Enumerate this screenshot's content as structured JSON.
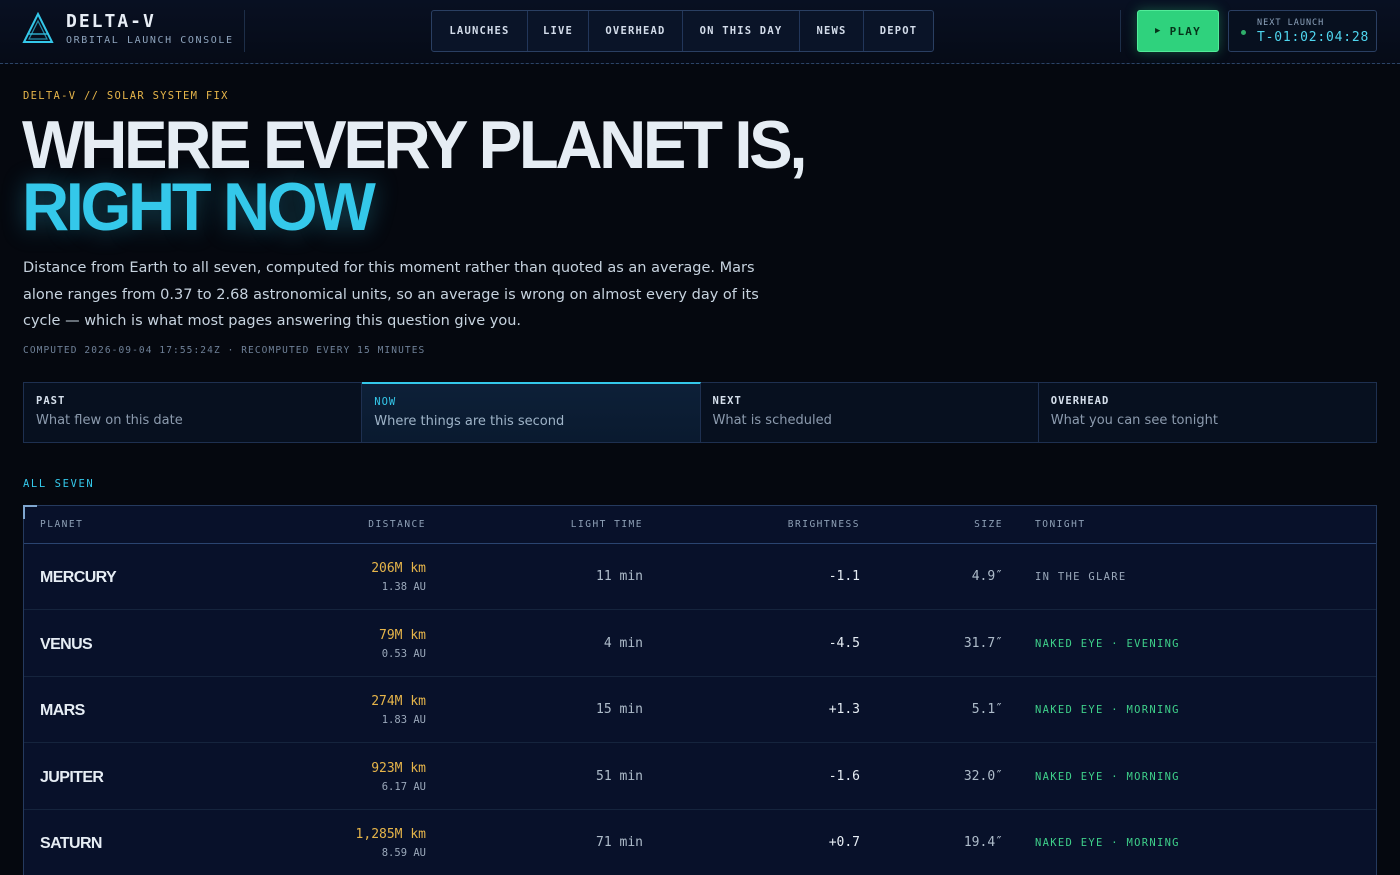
{
  "header": {
    "brand_name": "DELTA-V",
    "brand_sub": "ORBITAL LAUNCH CONSOLE",
    "nav": [
      "LAUNCHES",
      "LIVE",
      "OVERHEAD",
      "ON THIS DAY",
      "NEWS",
      "DEPOT"
    ],
    "play_label": "PLAY",
    "next_launch_label": "NEXT LAUNCH",
    "next_launch_value": "T-01:02:04:28"
  },
  "hero": {
    "kicker": "DELTA-V // SOLAR SYSTEM FIX",
    "title_line1": "WHERE EVERY PLANET IS,",
    "title_line2": "RIGHT NOW",
    "lede": "Distance from Earth to all seven, computed for this moment rather than quoted as an average. Mars alone ranges from 0.37 to 2.68 astronomical units, so an average is wrong on almost every day of its cycle — which is what most pages answering this question give you.",
    "computed": "COMPUTED 2026-09-04 17:55:24Z · RECOMPUTED EVERY 15 MINUTES"
  },
  "tabs": [
    {
      "key": "PAST",
      "desc": "What flew on this date",
      "active": false
    },
    {
      "key": "NOW",
      "desc": "Where things are this second",
      "active": true
    },
    {
      "key": "NEXT",
      "desc": "What is scheduled",
      "active": false
    },
    {
      "key": "OVERHEAD",
      "desc": "What you can see tonight",
      "active": false
    }
  ],
  "table": {
    "section_label": "ALL SEVEN",
    "headers": {
      "planet": "PLANET",
      "distance": "DISTANCE",
      "light_time": "LIGHT TIME",
      "brightness": "BRIGHTNESS",
      "size": "SIZE",
      "tonight": "TONIGHT"
    },
    "rows": [
      {
        "planet": "MERCURY",
        "km": "206M km",
        "au": "1.38 AU",
        "light": "11 min",
        "brightness": "-1.1",
        "size": "4.9″",
        "tonight": "IN THE GLARE",
        "visible": false
      },
      {
        "planet": "VENUS",
        "km": "79M km",
        "au": "0.53 AU",
        "light": "4 min",
        "brightness": "-4.5",
        "size": "31.7″",
        "tonight": "NAKED EYE · EVENING",
        "visible": true
      },
      {
        "planet": "MARS",
        "km": "274M km",
        "au": "1.83 AU",
        "light": "15 min",
        "brightness": "+1.3",
        "size": "5.1″",
        "tonight": "NAKED EYE · MORNING",
        "visible": true
      },
      {
        "planet": "JUPITER",
        "km": "923M km",
        "au": "6.17 AU",
        "light": "51 min",
        "brightness": "-1.6",
        "size": "32.0″",
        "tonight": "NAKED EYE · MORNING",
        "visible": true
      },
      {
        "planet": "SATURN",
        "km": "1,285M km",
        "au": "8.59 AU",
        "light": "71 min",
        "brightness": "+0.7",
        "size": "19.4″",
        "tonight": "NAKED EYE · MORNING",
        "visible": true
      }
    ]
  },
  "colors": {
    "accent": "#34c8ea",
    "gold": "#e6b54a",
    "visible_green": "#3ed08a",
    "play_green": "#2fd27d",
    "background": "#05080f"
  }
}
